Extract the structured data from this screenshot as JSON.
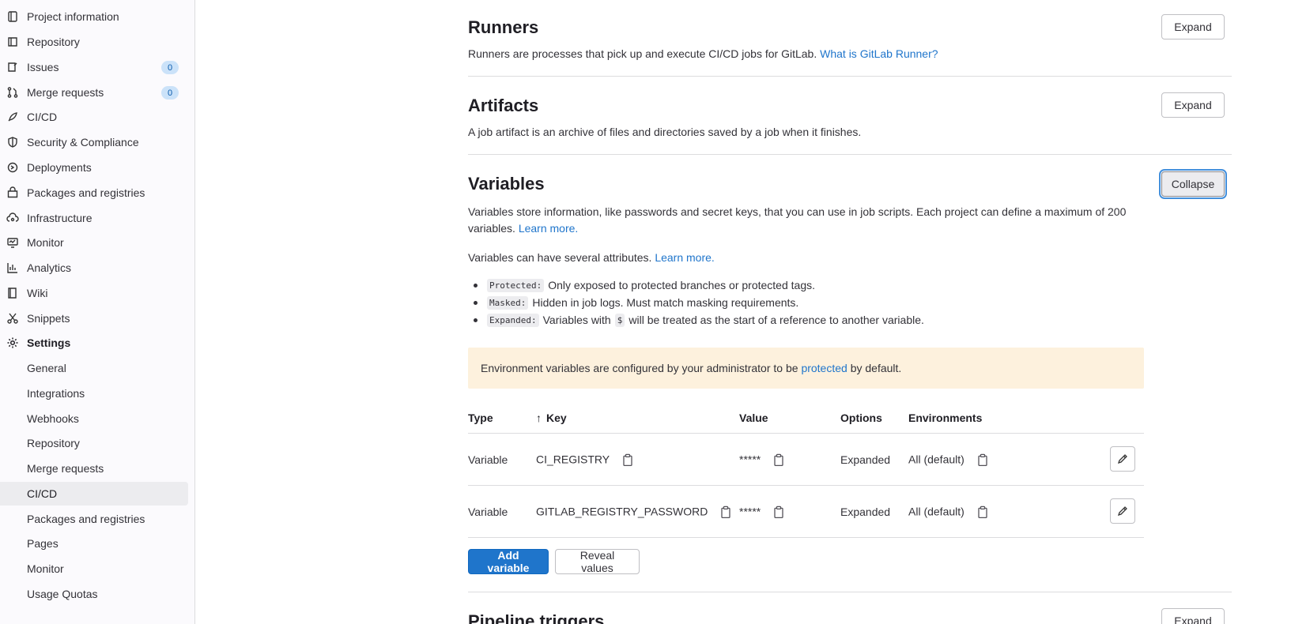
{
  "sidebar": {
    "items": [
      {
        "label": "Project information",
        "icon": "project-icon"
      },
      {
        "label": "Repository",
        "icon": "repository-icon"
      },
      {
        "label": "Issues",
        "icon": "issues-icon",
        "count": "0"
      },
      {
        "label": "Merge requests",
        "icon": "merge-request-icon",
        "count": "0"
      },
      {
        "label": "CI/CD",
        "icon": "rocket-icon"
      },
      {
        "label": "Security & Compliance",
        "icon": "shield-icon"
      },
      {
        "label": "Deployments",
        "icon": "deployments-icon"
      },
      {
        "label": "Packages and registries",
        "icon": "package-icon"
      },
      {
        "label": "Infrastructure",
        "icon": "cloud-gear-icon"
      },
      {
        "label": "Monitor",
        "icon": "monitor-icon"
      },
      {
        "label": "Analytics",
        "icon": "chart-icon"
      },
      {
        "label": "Wiki",
        "icon": "book-icon"
      },
      {
        "label": "Snippets",
        "icon": "scissors-icon"
      },
      {
        "label": "Settings",
        "icon": "settings-icon"
      }
    ],
    "settings_sub": [
      "General",
      "Integrations",
      "Webhooks",
      "Repository",
      "Merge requests",
      "CI/CD",
      "Packages and registries",
      "Pages",
      "Monitor",
      "Usage Quotas"
    ]
  },
  "runners": {
    "title": "Runners",
    "desc": "Runners are processes that pick up and execute CI/CD jobs for GitLab.",
    "link": "What is GitLab Runner?",
    "button": "Expand"
  },
  "artifacts": {
    "title": "Artifacts",
    "desc": "A job artifact is an archive of files and directories saved by a job when it finishes.",
    "button": "Expand"
  },
  "variables": {
    "title": "Variables",
    "desc_line1": "Variables store information, like passwords and secret keys, that you can use in job scripts. Each project can define a maximum of 200",
    "desc_line2": "variables.",
    "learn_more": "Learn more.",
    "attrs_intro": "Variables can have several attributes.",
    "attrs_learn_more": "Learn more.",
    "button": "Collapse",
    "attrs": [
      {
        "tag": "Protected:",
        "text": "Only exposed to protected branches or protected tags."
      },
      {
        "tag": "Masked:",
        "text": "Hidden in job logs. Must match masking requirements."
      },
      {
        "tag": "Expanded:",
        "text_before": "Variables with",
        "code": "$",
        "text_after": "will be treated as the start of a reference to another variable."
      }
    ],
    "alert": {
      "before": "Environment variables are configured by your administrator to be",
      "link": "protected",
      "after": "by default."
    },
    "table": {
      "headers": {
        "type": "Type",
        "key": "Key",
        "value": "Value",
        "options": "Options",
        "environments": "Environments"
      },
      "rows": [
        {
          "type": "Variable",
          "key": "CI_REGISTRY",
          "value": "*****",
          "options": "Expanded",
          "environment": "All (default)"
        },
        {
          "type": "Variable",
          "key": "GITLAB_REGISTRY_PASSWORD",
          "value": "*****",
          "options": "Expanded",
          "environment": "All (default)"
        }
      ]
    },
    "add_button": "Add variable",
    "reveal_button": "Reveal values"
  },
  "pipeline_triggers": {
    "title": "Pipeline triggers",
    "button": "Expand"
  }
}
